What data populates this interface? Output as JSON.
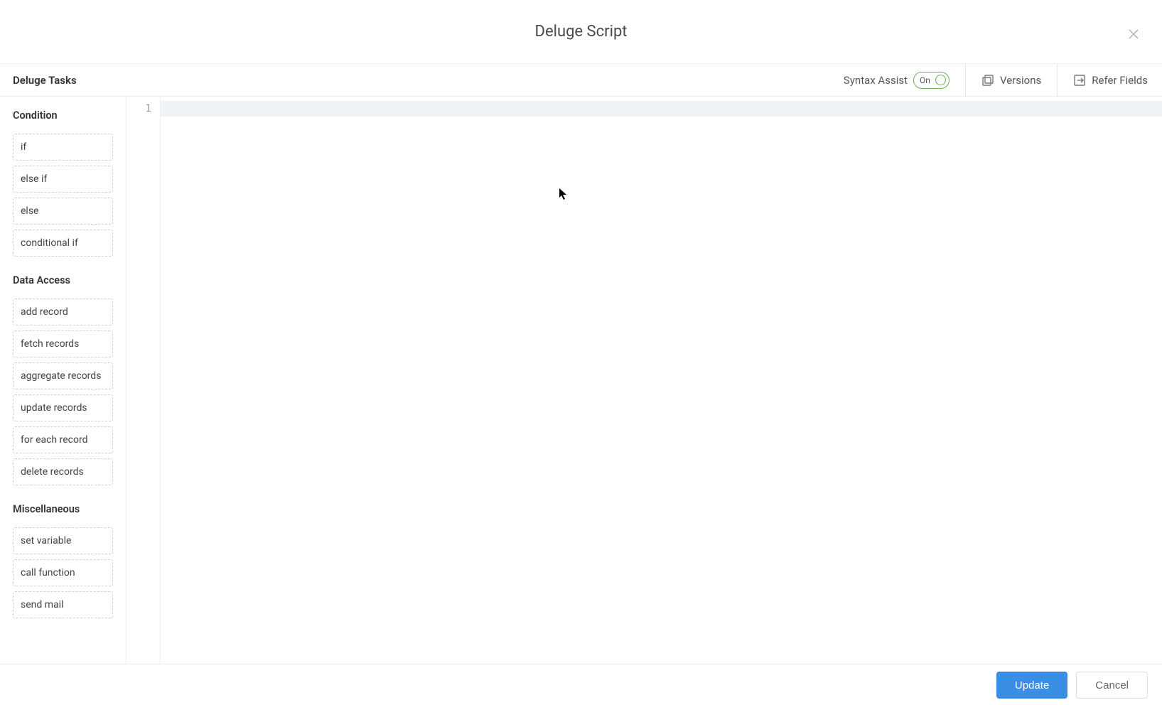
{
  "header": {
    "title": "Deluge Script"
  },
  "toolbar": {
    "tasks_header": "Deluge Tasks",
    "syntax_assist_label": "Syntax Assist",
    "syntax_assist_state": "On",
    "versions_label": "Versions",
    "refer_fields_label": "Refer Fields"
  },
  "sidebar": {
    "sections": [
      {
        "title": "Condition",
        "items": [
          "if",
          "else if",
          "else",
          "conditional if"
        ]
      },
      {
        "title": "Data Access",
        "items": [
          "add record",
          "fetch records",
          "aggregate records",
          "update records",
          "for each record",
          "delete records"
        ]
      },
      {
        "title": "Miscellaneous",
        "items": [
          "set variable",
          "call function",
          "send mail"
        ]
      }
    ]
  },
  "editor": {
    "line_numbers": [
      "1"
    ]
  },
  "footer": {
    "update_label": "Update",
    "cancel_label": "Cancel"
  }
}
